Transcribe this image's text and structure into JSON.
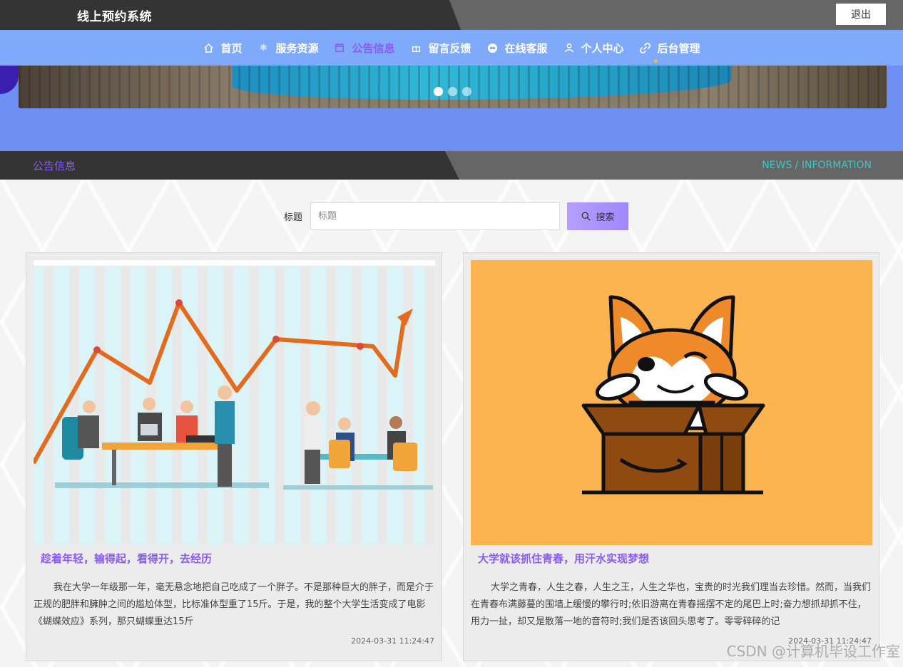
{
  "header": {
    "site_title": "线上预约系统",
    "logout_label": "退出"
  },
  "nav": {
    "items": [
      {
        "label": "首页",
        "icon": "home-icon"
      },
      {
        "label": "服务资源",
        "icon": "snowflake-icon"
      },
      {
        "label": "公告信息",
        "icon": "calendar-icon",
        "active": true
      },
      {
        "label": "留言反馈",
        "icon": "gift-icon"
      },
      {
        "label": "在线客服",
        "icon": "chat-icon"
      },
      {
        "label": "个人中心",
        "icon": "user-icon"
      },
      {
        "label": "后台管理",
        "icon": "link-icon"
      }
    ]
  },
  "banner": {
    "slides": 3,
    "active_slide": 1
  },
  "section": {
    "title": "公告信息",
    "subtitle": "NEWS / INFORMATION"
  },
  "search": {
    "label": "标题",
    "placeholder": "标题",
    "button_label": "搜索"
  },
  "cards": [
    {
      "title": "趁着年轻，输得起，看得开，去经历",
      "text": "我在大学一年级那一年，毫无悬念地把自己吃成了一个胖子。不是那种巨大的胖子，而是介于正规的肥胖和臃肿之间的尴尬体型，比标准体型重了15斤。于是，我的整个大学生活变成了电影《蝴蝶效应》系列，那只蝴蝶重达15斤",
      "date": "2024-03-31 11:24:47",
      "image": "office-teamwork-chart-illustration"
    },
    {
      "title": "大学就该抓住青春，用汗水实现梦想",
      "text": "大学之青春，人生之春，人生之王，人生之华也，宝贵的时光我们理当去珍惜。然而，当我们在青春布满藤蔓的围墙上缓慢的攀行时;依旧游离在青春摇摆不定的尾巴上时;奋力想抓却抓不住，用力一扯，却又是散落一地的音符时;我们是否该回头思考了。零零碎碎的记",
      "date": "2024-03-31 11:24:47",
      "image": "corgi-in-box-illustration"
    }
  ],
  "watermark": "CSDN @计算机毕设工作室",
  "colors": {
    "accent": "#8a5cf6",
    "nav_bg": "#7fa9fb",
    "banner_bg": "#6d8ef3",
    "teal": "#43c2c6"
  }
}
